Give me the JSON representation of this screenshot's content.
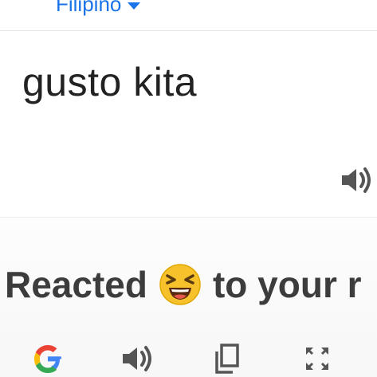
{
  "source_lang": {
    "label": "Filipino"
  },
  "source": {
    "text": "gusto kita"
  },
  "reaction": {
    "before": "Reacted",
    "after": "to your r",
    "emoji_icon": "laughing-squinting-face-icon"
  },
  "toolbar": {
    "google_logo": "G",
    "icons": [
      "google-logo-icon",
      "speaker-icon",
      "copy-icon",
      "fullscreen-icon"
    ]
  },
  "colors": {
    "accent": "#1a73e8",
    "text": "#222222",
    "reaction_text": "#3c3c3c",
    "icon": "#555555"
  }
}
